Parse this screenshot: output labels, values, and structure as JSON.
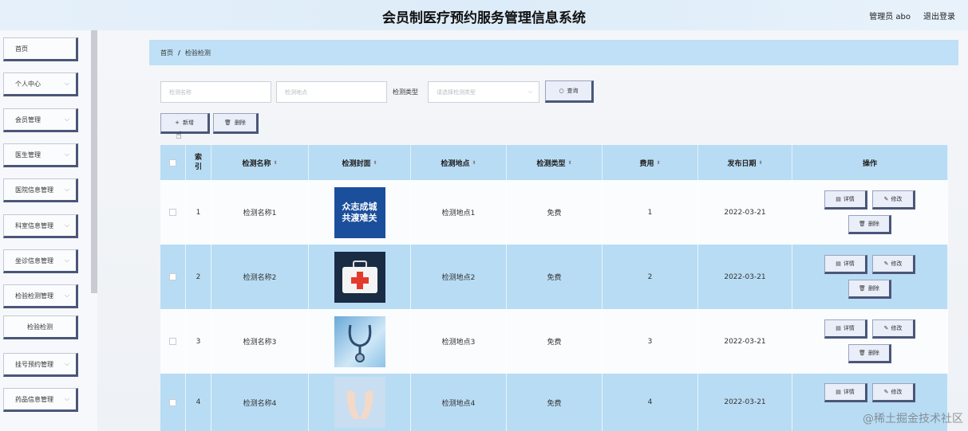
{
  "header": {
    "title": "会员制医疗预约服务管理信息系统",
    "admin": "管理员 abo",
    "logout": "退出登录"
  },
  "sidebar": {
    "items": [
      {
        "label": "首页",
        "has_chevron": false
      },
      {
        "label": "个人中心",
        "has_chevron": true
      },
      {
        "label": "会员管理",
        "has_chevron": true
      },
      {
        "label": "医生管理",
        "has_chevron": true
      },
      {
        "label": "医院信息管理",
        "has_chevron": true
      },
      {
        "label": "科室信息管理",
        "has_chevron": true
      },
      {
        "label": "坐诊信息管理",
        "has_chevron": true
      },
      {
        "label": "检验检测管理",
        "has_chevron": true
      },
      {
        "label": "检验检测",
        "has_chevron": false,
        "sub": true
      },
      {
        "label": "挂号预约管理",
        "has_chevron": true
      },
      {
        "label": "药品信息管理",
        "has_chevron": true
      }
    ]
  },
  "breadcrumb": {
    "home": "首页",
    "separator": "/",
    "current": "检验检测"
  },
  "search": {
    "name_placeholder": "检测名称",
    "location_placeholder": "检测地点",
    "type_label": "检测类型",
    "type_placeholder": "请选择检测类型",
    "query_button": "查询"
  },
  "actions": {
    "add": "新增",
    "delete": "删除"
  },
  "table": {
    "headers": [
      "索引",
      "检测名称",
      "检测封面",
      "检测地点",
      "检测类型",
      "费用",
      "发布日期",
      "操作"
    ],
    "rows": [
      {
        "index": "1",
        "name": "检测名称1",
        "location": "检测地点1",
        "type": "免费",
        "fee": "1",
        "date": "2022-03-21",
        "cover_text": [
          "众志成城",
          "共渡难关"
        ]
      },
      {
        "index": "2",
        "name": "检测名称2",
        "location": "检测地点2",
        "type": "免费",
        "fee": "2",
        "date": "2022-03-21"
      },
      {
        "index": "3",
        "name": "检测名称3",
        "location": "检测地点3",
        "type": "免费",
        "fee": "3",
        "date": "2022-03-21"
      },
      {
        "index": "4",
        "name": "检测名称4",
        "location": "检测地点4",
        "type": "免费",
        "fee": "4",
        "date": "2022-03-21"
      }
    ],
    "op_labels": {
      "detail": "详情",
      "edit": "修改",
      "delete": "删除"
    }
  },
  "watermark": "@稀土掘金技术社区",
  "colors": {
    "accent_border": "#4b5679",
    "row_highlight": "#b8dcf4",
    "breadcrumb_bg": "#bfe0f6"
  }
}
